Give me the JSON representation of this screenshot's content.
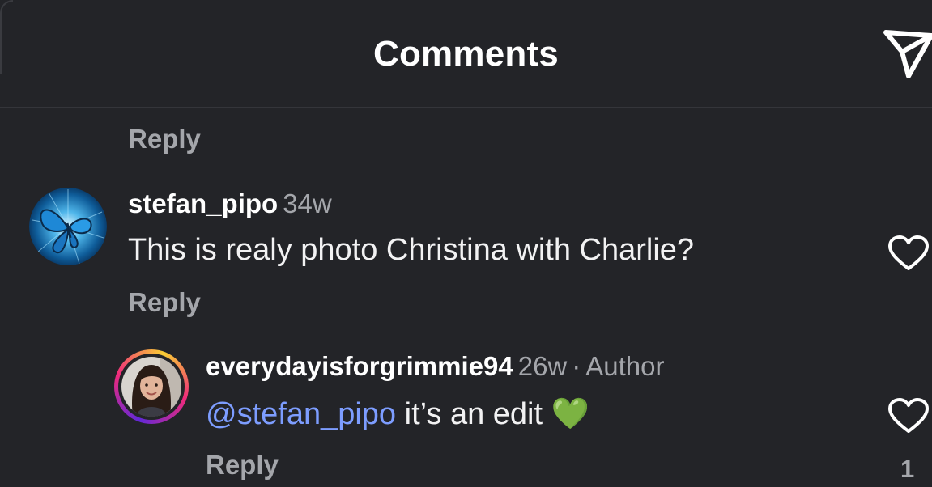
{
  "header": {
    "title": "Comments",
    "send_icon": "send-paper-plane-icon"
  },
  "top_reply": {
    "label": "Reply"
  },
  "comments": [
    {
      "username": "stefan_pipo",
      "age": "34w",
      "text": "This is realy photo Christina with Charlie?",
      "reply_label": "Reply",
      "avatar": "blue-butterfly-avatar",
      "like_icon": "heart-outline-icon"
    },
    {
      "username": "everydayisforgrimmie94",
      "age": "26w",
      "separator": "·",
      "role": "Author",
      "mention": "@stefan_pipo",
      "text": "it’s an edit",
      "emoji": "💚",
      "reply_label": "Reply",
      "avatar": "woman-portrait-story-ring-avatar",
      "like_icon": "heart-outline-icon",
      "like_count": "1"
    }
  ],
  "colors": {
    "background": "#232428",
    "text_primary": "#ffffff",
    "text_secondary": "#a4a6ab",
    "mention": "#7d9dff",
    "story_ring_start": "#f9ce34",
    "story_ring_mid": "#ee2a7b",
    "story_ring_end": "#6228d7"
  }
}
